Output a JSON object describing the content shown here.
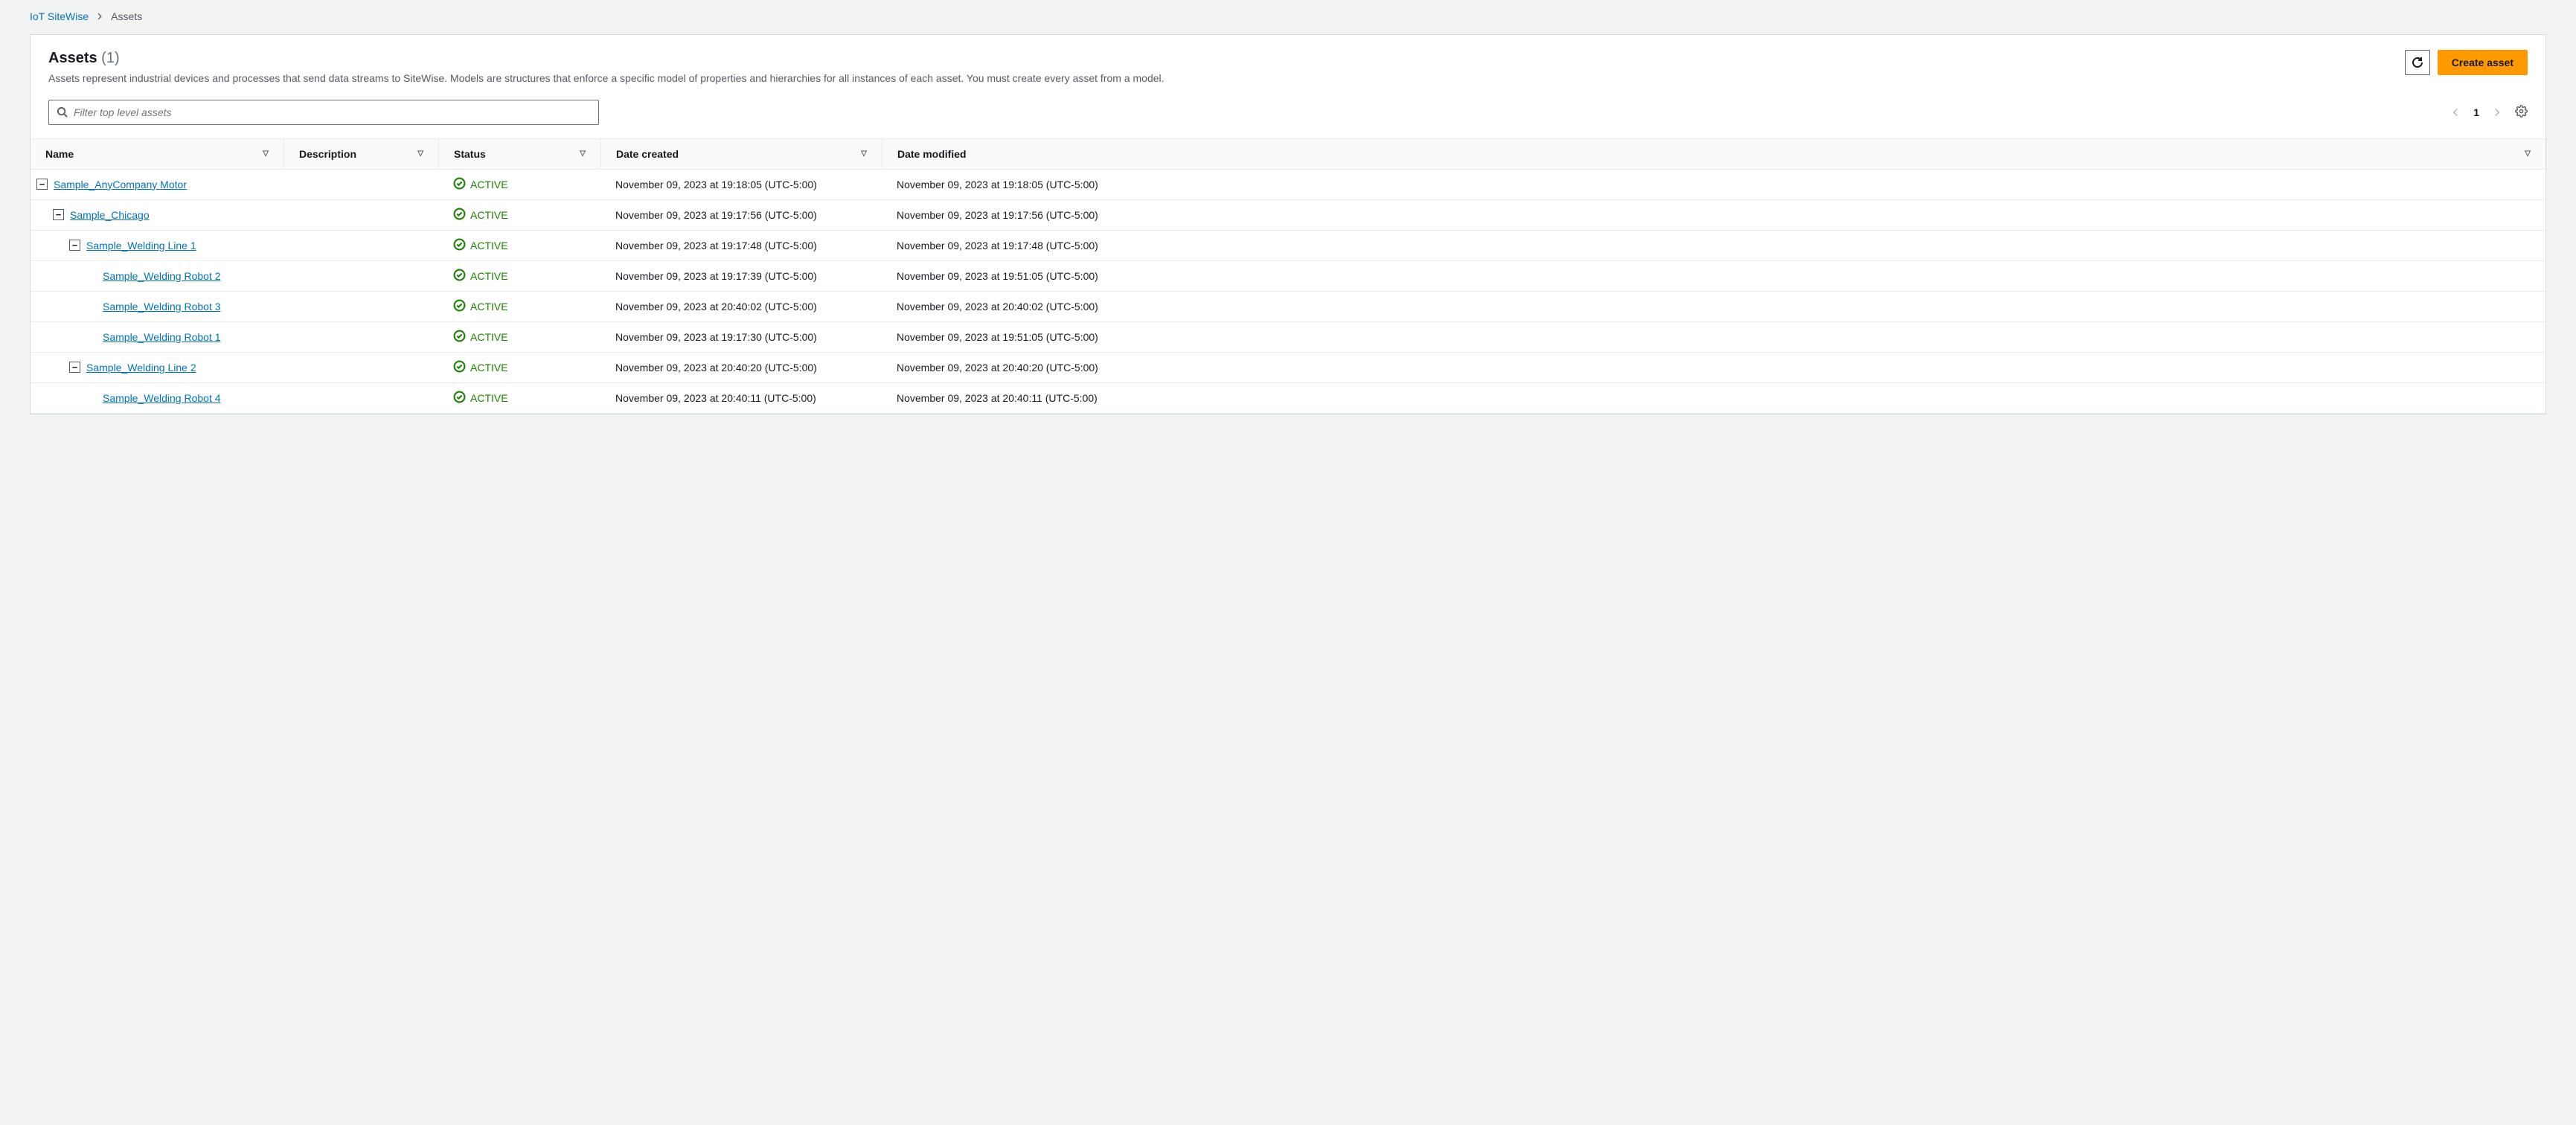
{
  "breadcrumb": {
    "root": "IoT SiteWise",
    "current": "Assets"
  },
  "header": {
    "title": "Assets",
    "count": "(1)",
    "description": "Assets represent industrial devices and processes that send data streams to SiteWise. Models are structures that enforce a specific model of properties and hierarchies for all instances of each asset. You must create every asset from a model.",
    "create_label": "Create asset"
  },
  "search": {
    "placeholder": "Filter top level assets"
  },
  "pagination": {
    "page": "1"
  },
  "columns": {
    "name": "Name",
    "description": "Description",
    "status": "Status",
    "created": "Date created",
    "modified": "Date modified"
  },
  "status_label": "ACTIVE",
  "rows": [
    {
      "level": 0,
      "toggle": "minus",
      "name": "Sample_AnyCompany Motor",
      "created": "November 09, 2023 at 19:18:05 (UTC-5:00)",
      "modified": "November 09, 2023 at 19:18:05 (UTC-5:00)"
    },
    {
      "level": 1,
      "toggle": "minus",
      "name": "Sample_Chicago",
      "created": "November 09, 2023 at 19:17:56 (UTC-5:00)",
      "modified": "November 09, 2023 at 19:17:56 (UTC-5:00)"
    },
    {
      "level": 2,
      "toggle": "minus",
      "name": "Sample_Welding Line 1",
      "created": "November 09, 2023 at 19:17:48 (UTC-5:00)",
      "modified": "November 09, 2023 at 19:17:48 (UTC-5:00)"
    },
    {
      "level": 3,
      "toggle": "none",
      "name": "Sample_Welding Robot 2",
      "created": "November 09, 2023 at 19:17:39 (UTC-5:00)",
      "modified": "November 09, 2023 at 19:51:05 (UTC-5:00)"
    },
    {
      "level": 3,
      "toggle": "none",
      "name": "Sample_Welding Robot 3",
      "created": "November 09, 2023 at 20:40:02 (UTC-5:00)",
      "modified": "November 09, 2023 at 20:40:02 (UTC-5:00)"
    },
    {
      "level": 3,
      "toggle": "none",
      "name": "Sample_Welding Robot 1",
      "created": "November 09, 2023 at 19:17:30 (UTC-5:00)",
      "modified": "November 09, 2023 at 19:51:05 (UTC-5:00)"
    },
    {
      "level": 2,
      "toggle": "minus",
      "name": "Sample_Welding Line 2",
      "created": "November 09, 2023 at 20:40:20 (UTC-5:00)",
      "modified": "November 09, 2023 at 20:40:20 (UTC-5:00)"
    },
    {
      "level": 3,
      "toggle": "none",
      "name": "Sample_Welding Robot 4",
      "created": "November 09, 2023 at 20:40:11 (UTC-5:00)",
      "modified": "November 09, 2023 at 20:40:11 (UTC-5:00)"
    }
  ]
}
